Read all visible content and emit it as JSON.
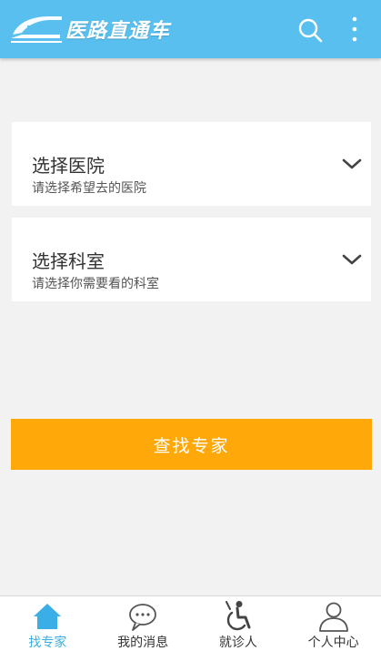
{
  "header": {
    "app_name": "医路直通车",
    "logo_icon": "train-icon",
    "search_icon": "search-icon",
    "menu_icon": "more-vertical-icon",
    "background_color": "#58bfee"
  },
  "selectors": [
    {
      "title": "选择医院",
      "subtitle": "请选择希望去的医院",
      "icon": "chevron-down-icon"
    },
    {
      "title": "选择科室",
      "subtitle": "请选择你需要看的科室",
      "icon": "chevron-down-icon"
    }
  ],
  "search_button": {
    "label": "查找专家",
    "color": "#ffa80a"
  },
  "bottom_nav": {
    "active_color": "#3aaee6",
    "items": [
      {
        "label": "找专家",
        "icon": "home-icon",
        "active": true
      },
      {
        "label": "我的消息",
        "icon": "chat-bubble-icon",
        "active": false
      },
      {
        "label": "就诊人",
        "icon": "wheelchair-icon",
        "active": false
      },
      {
        "label": "个人中心",
        "icon": "user-icon",
        "active": false
      }
    ]
  }
}
